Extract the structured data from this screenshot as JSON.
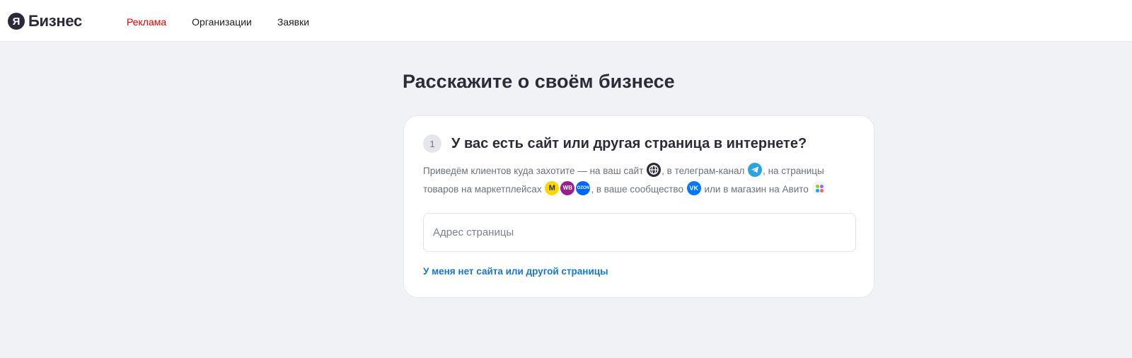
{
  "header": {
    "logo_mark": "Я",
    "logo_text": "Бизнес",
    "nav": [
      {
        "label": "Реклама",
        "active": true
      },
      {
        "label": "Организации",
        "active": false
      },
      {
        "label": "Заявки",
        "active": false
      }
    ]
  },
  "main": {
    "title": "Расскажите о своём бизнесе",
    "card": {
      "step_number": "1",
      "question": "У вас есть сайт или другая страница в интернете?",
      "desc_part1": "Приведём клиентов куда захотите — на ваш сайт",
      "desc_part2": ", в телеграм-канал",
      "desc_part3": ", на страницы товаров на маркетплейсах",
      "desc_part4": ", в ваше сообщество",
      "desc_part5": "или в магазин на Авито",
      "icons": {
        "globe": "globe-icon",
        "telegram": "telegram-icon",
        "yandex_market": "yandex-market-icon",
        "wildberries": "wildberries-icon",
        "ozon": "ozon-icon",
        "vk": "vk-icon",
        "avito": "avito-icon"
      },
      "icon_text": {
        "wb": "WB",
        "ozon": "OZON",
        "vk": "VK",
        "ym": "M"
      },
      "input_placeholder": "Адрес страницы",
      "input_value": "",
      "no_site_link": "У меня нет сайта или другой страницы"
    }
  },
  "colors": {
    "accent_red": "#e60000",
    "link_blue": "#1677d4",
    "background": "#f1f2f6"
  }
}
